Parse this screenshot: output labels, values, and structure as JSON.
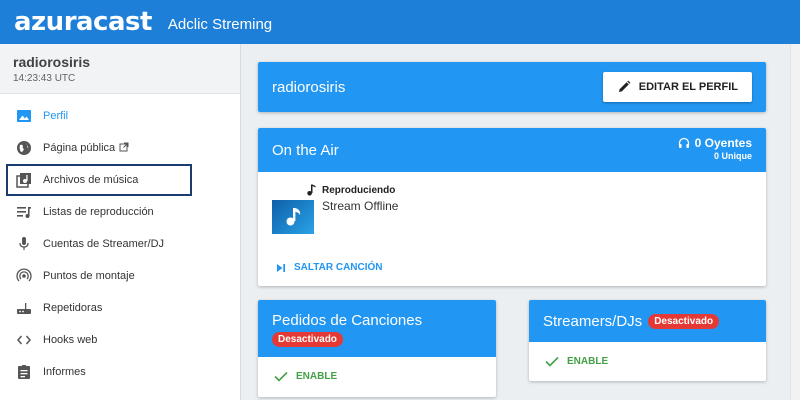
{
  "header": {
    "logo": "azuracast",
    "station_title": "Adclic Streming"
  },
  "sidebar": {
    "station_name": "radiorosiris",
    "time": "14:23:43 UTC",
    "items": [
      {
        "label": "Perfil",
        "icon": "image-icon"
      },
      {
        "label": "Página pública",
        "icon": "globe-icon"
      },
      {
        "label": "Archivos de música",
        "icon": "music-library-icon"
      },
      {
        "label": "Listas de reproducción",
        "icon": "queue-music-icon"
      },
      {
        "label": "Cuentas de Streamer/DJ",
        "icon": "mic-icon"
      },
      {
        "label": "Puntos de montaje",
        "icon": "broadcast-icon"
      },
      {
        "label": "Repetidoras",
        "icon": "router-icon"
      },
      {
        "label": "Hooks web",
        "icon": "code-icon"
      },
      {
        "label": "Informes",
        "icon": "assignment-icon"
      }
    ]
  },
  "profile_card": {
    "title": "radiorosiris",
    "edit_label": "EDITAR EL PERFIL"
  },
  "on_air": {
    "title": "On the Air",
    "listeners": "0 Oyentes",
    "unique": "0 Unique",
    "playing_label": "Reproduciendo",
    "stream_status": "Stream Offline",
    "skip_label": "SALTAR CANCIÓN"
  },
  "requests_card": {
    "title": "Pedidos de Canciones",
    "badge": "Desactivado",
    "enable_label": "ENABLE"
  },
  "djs_card": {
    "title": "Streamers/DJs",
    "badge": "Desactivado",
    "enable_label": "ENABLE"
  },
  "colors": {
    "primary": "#2196f3",
    "header": "#1e7fd8",
    "danger": "#e53935",
    "success": "#43a047",
    "highlight_border": "#1b3d6d"
  }
}
